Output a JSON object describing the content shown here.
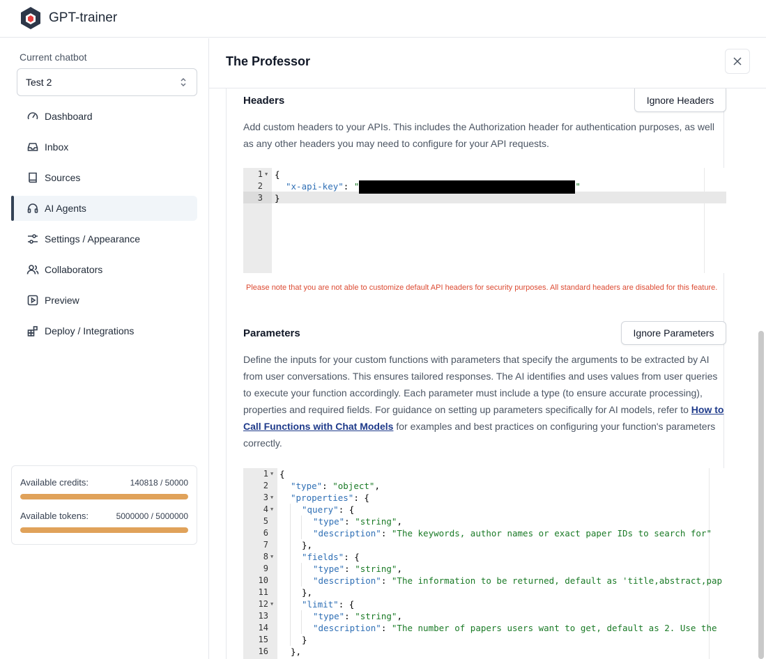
{
  "app": {
    "brand_name": "GPT-trainer",
    "brand_color": "#2d3748",
    "accent_color": "#e0a25a",
    "logo_icon": "hexagon-cube-logo"
  },
  "sidebar": {
    "current_chatbot_label": "Current chatbot",
    "current_chatbot_value": "Test 2",
    "items": [
      {
        "label": "Dashboard",
        "icon": "gauge-icon"
      },
      {
        "label": "Inbox",
        "icon": "inbox-icon"
      },
      {
        "label": "Sources",
        "icon": "book-icon"
      },
      {
        "label": "AI Agents",
        "icon": "headset-icon",
        "active": true
      },
      {
        "label": "Settings / Appearance",
        "icon": "sliders-icon"
      },
      {
        "label": "Collaborators",
        "icon": "users-icon"
      },
      {
        "label": "Preview",
        "icon": "play-icon"
      },
      {
        "label": "Deploy / Integrations",
        "icon": "blocks-icon"
      }
    ],
    "credits": {
      "credits_label": "Available credits:",
      "credits_value": "140818 / 50000",
      "credits_fill": 1.0,
      "tokens_label": "Available tokens:",
      "tokens_value": "5000000 / 5000000",
      "tokens_fill": 1.0
    }
  },
  "panel": {
    "title": "The Professor",
    "close_icon": "close-icon",
    "headers": {
      "title": "Headers",
      "ignore_button": "Ignore Headers",
      "description": "Add custom headers to your APIs. This includes the Authorization header for authentication purposes, as well as any other headers you may need to configure for your API requests.",
      "code": {
        "line1": "{",
        "key": "\"x-api-key\"",
        "colon": ": ",
        "quote_open": "\"",
        "quote_close": "\"",
        "line3": "}"
      },
      "warning": "Please note that you are not able to customize default API headers for security purposes. All standard headers are disabled for this feature."
    },
    "parameters": {
      "title": "Parameters",
      "ignore_button": "Ignore Parameters",
      "desc_before": "Define the inputs for your custom functions with parameters that specify the arguments to be extracted by AI from user conversations. This ensures tailored responses. The AI identifies and uses values from user queries to execute your function accordingly. Each parameter must include a type (to ensure accurate processing), properties and required fields. For guidance on setting up parameters specifically for AI models, refer to ",
      "desc_link": "How to Call Functions with Chat Models",
      "desc_after": " for examples and best practices on configuring your function's parameters correctly.",
      "code_lines": [
        {
          "n": "1",
          "fold": true,
          "indent": 0,
          "parts": [
            [
              "p",
              "{"
            ]
          ]
        },
        {
          "n": "2",
          "indent": 1,
          "parts": [
            [
              "k",
              "\"type\""
            ],
            [
              "p",
              ": "
            ],
            [
              "s",
              "\"object\""
            ],
            [
              "p",
              ","
            ]
          ]
        },
        {
          "n": "3",
          "fold": true,
          "indent": 1,
          "parts": [
            [
              "k",
              "\"properties\""
            ],
            [
              "p",
              ": {"
            ]
          ]
        },
        {
          "n": "4",
          "fold": true,
          "indent": 2,
          "parts": [
            [
              "k",
              "\"query\""
            ],
            [
              "p",
              ": {"
            ]
          ]
        },
        {
          "n": "5",
          "indent": 3,
          "parts": [
            [
              "k",
              "\"type\""
            ],
            [
              "p",
              ": "
            ],
            [
              "s",
              "\"string\""
            ],
            [
              "p",
              ","
            ]
          ]
        },
        {
          "n": "6",
          "indent": 3,
          "parts": [
            [
              "k",
              "\"description\""
            ],
            [
              "p",
              ": "
            ],
            [
              "s",
              "\"The keywords, author names or exact paper IDs to search for\""
            ]
          ]
        },
        {
          "n": "7",
          "indent": 2,
          "parts": [
            [
              "p",
              "},"
            ]
          ]
        },
        {
          "n": "8",
          "fold": true,
          "indent": 2,
          "parts": [
            [
              "k",
              "\"fields\""
            ],
            [
              "p",
              ": {"
            ]
          ]
        },
        {
          "n": "9",
          "indent": 3,
          "parts": [
            [
              "k",
              "\"type\""
            ],
            [
              "p",
              ": "
            ],
            [
              "s",
              "\"string\""
            ],
            [
              "p",
              ","
            ]
          ]
        },
        {
          "n": "10",
          "indent": 3,
          "parts": [
            [
              "k",
              "\"description\""
            ],
            [
              "p",
              ": "
            ],
            [
              "s",
              "\"The information to be returned, default as 'title,abstract,pap"
            ]
          ]
        },
        {
          "n": "11",
          "indent": 2,
          "parts": [
            [
              "p",
              "},"
            ]
          ]
        },
        {
          "n": "12",
          "fold": true,
          "indent": 2,
          "parts": [
            [
              "k",
              "\"limit\""
            ],
            [
              "p",
              ": {"
            ]
          ]
        },
        {
          "n": "13",
          "indent": 3,
          "parts": [
            [
              "k",
              "\"type\""
            ],
            [
              "p",
              ": "
            ],
            [
              "s",
              "\"string\""
            ],
            [
              "p",
              ","
            ]
          ]
        },
        {
          "n": "14",
          "indent": 3,
          "parts": [
            [
              "k",
              "\"description\""
            ],
            [
              "p",
              ": "
            ],
            [
              "s",
              "\"The number of papers users want to get, default as 2. Use the"
            ]
          ]
        },
        {
          "n": "15",
          "indent": 2,
          "parts": [
            [
              "p",
              "}"
            ]
          ]
        },
        {
          "n": "16",
          "indent": 1,
          "parts": [
            [
              "p",
              "},"
            ]
          ]
        }
      ]
    }
  }
}
